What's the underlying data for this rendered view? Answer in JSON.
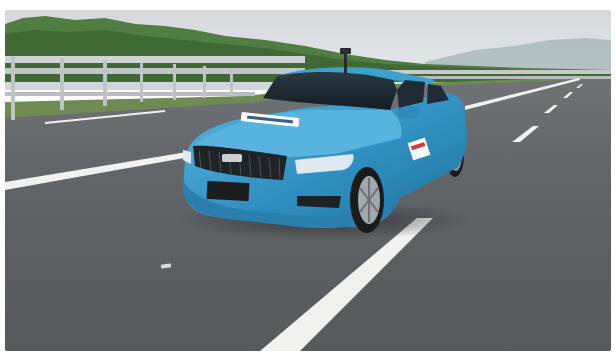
{
  "scene": {
    "colors": {
      "sky_top": "#d7dbde",
      "sky_bottom": "#e8eaeb",
      "hills": "#8ea6a3",
      "trees": "#4c7a3f",
      "road": "#5f6264",
      "road_dark": "#54575a",
      "lane_mark": "#f1f1ef",
      "guardrail": "#cfd3d6",
      "car_body": "#2f8fc0",
      "car_body_light": "#52b0dd",
      "car_glass": "#1d2b34",
      "car_tire": "#1a1b1d",
      "grille": "#1f2326",
      "headlight": "#dfe9f2"
    },
    "icons": {
      "car": "car-icon",
      "brand_badge": "badge-icon",
      "roof_sensor": "antenna-icon"
    }
  }
}
